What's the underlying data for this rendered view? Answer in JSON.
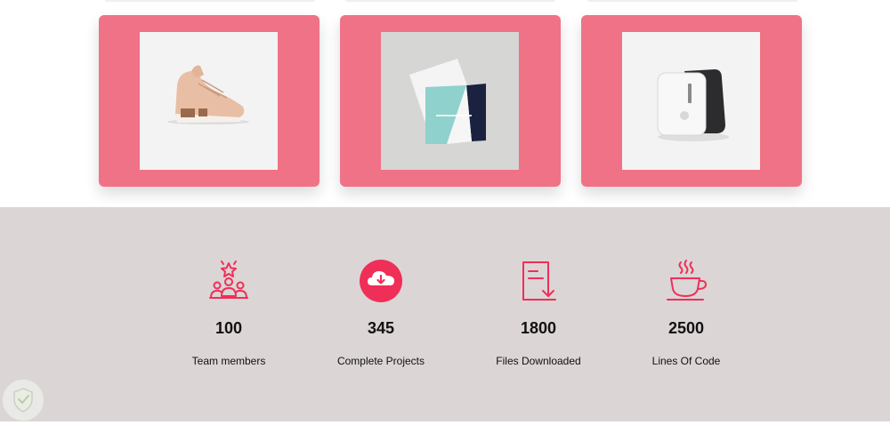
{
  "colors": {
    "accent": "#f07286",
    "icon": "#ef2f57",
    "stats_bg": "#dbd5d6"
  },
  "portfolio": {
    "cards": [
      {
        "image": "pink-sneaker-image"
      },
      {
        "image": "business-cards-image"
      },
      {
        "image": "portable-device-image"
      }
    ]
  },
  "stats": [
    {
      "icon": "team-members-icon",
      "number": "100",
      "label": "Team members"
    },
    {
      "icon": "cloud-download-icon",
      "number": "345",
      "label": "Complete Projects"
    },
    {
      "icon": "file-download-icon",
      "number": "1800",
      "label": "Files Downloaded"
    },
    {
      "icon": "coffee-cup-icon",
      "number": "2500",
      "label": "Lines Of Code"
    }
  ],
  "badge": {
    "icon": "shield-icon"
  }
}
